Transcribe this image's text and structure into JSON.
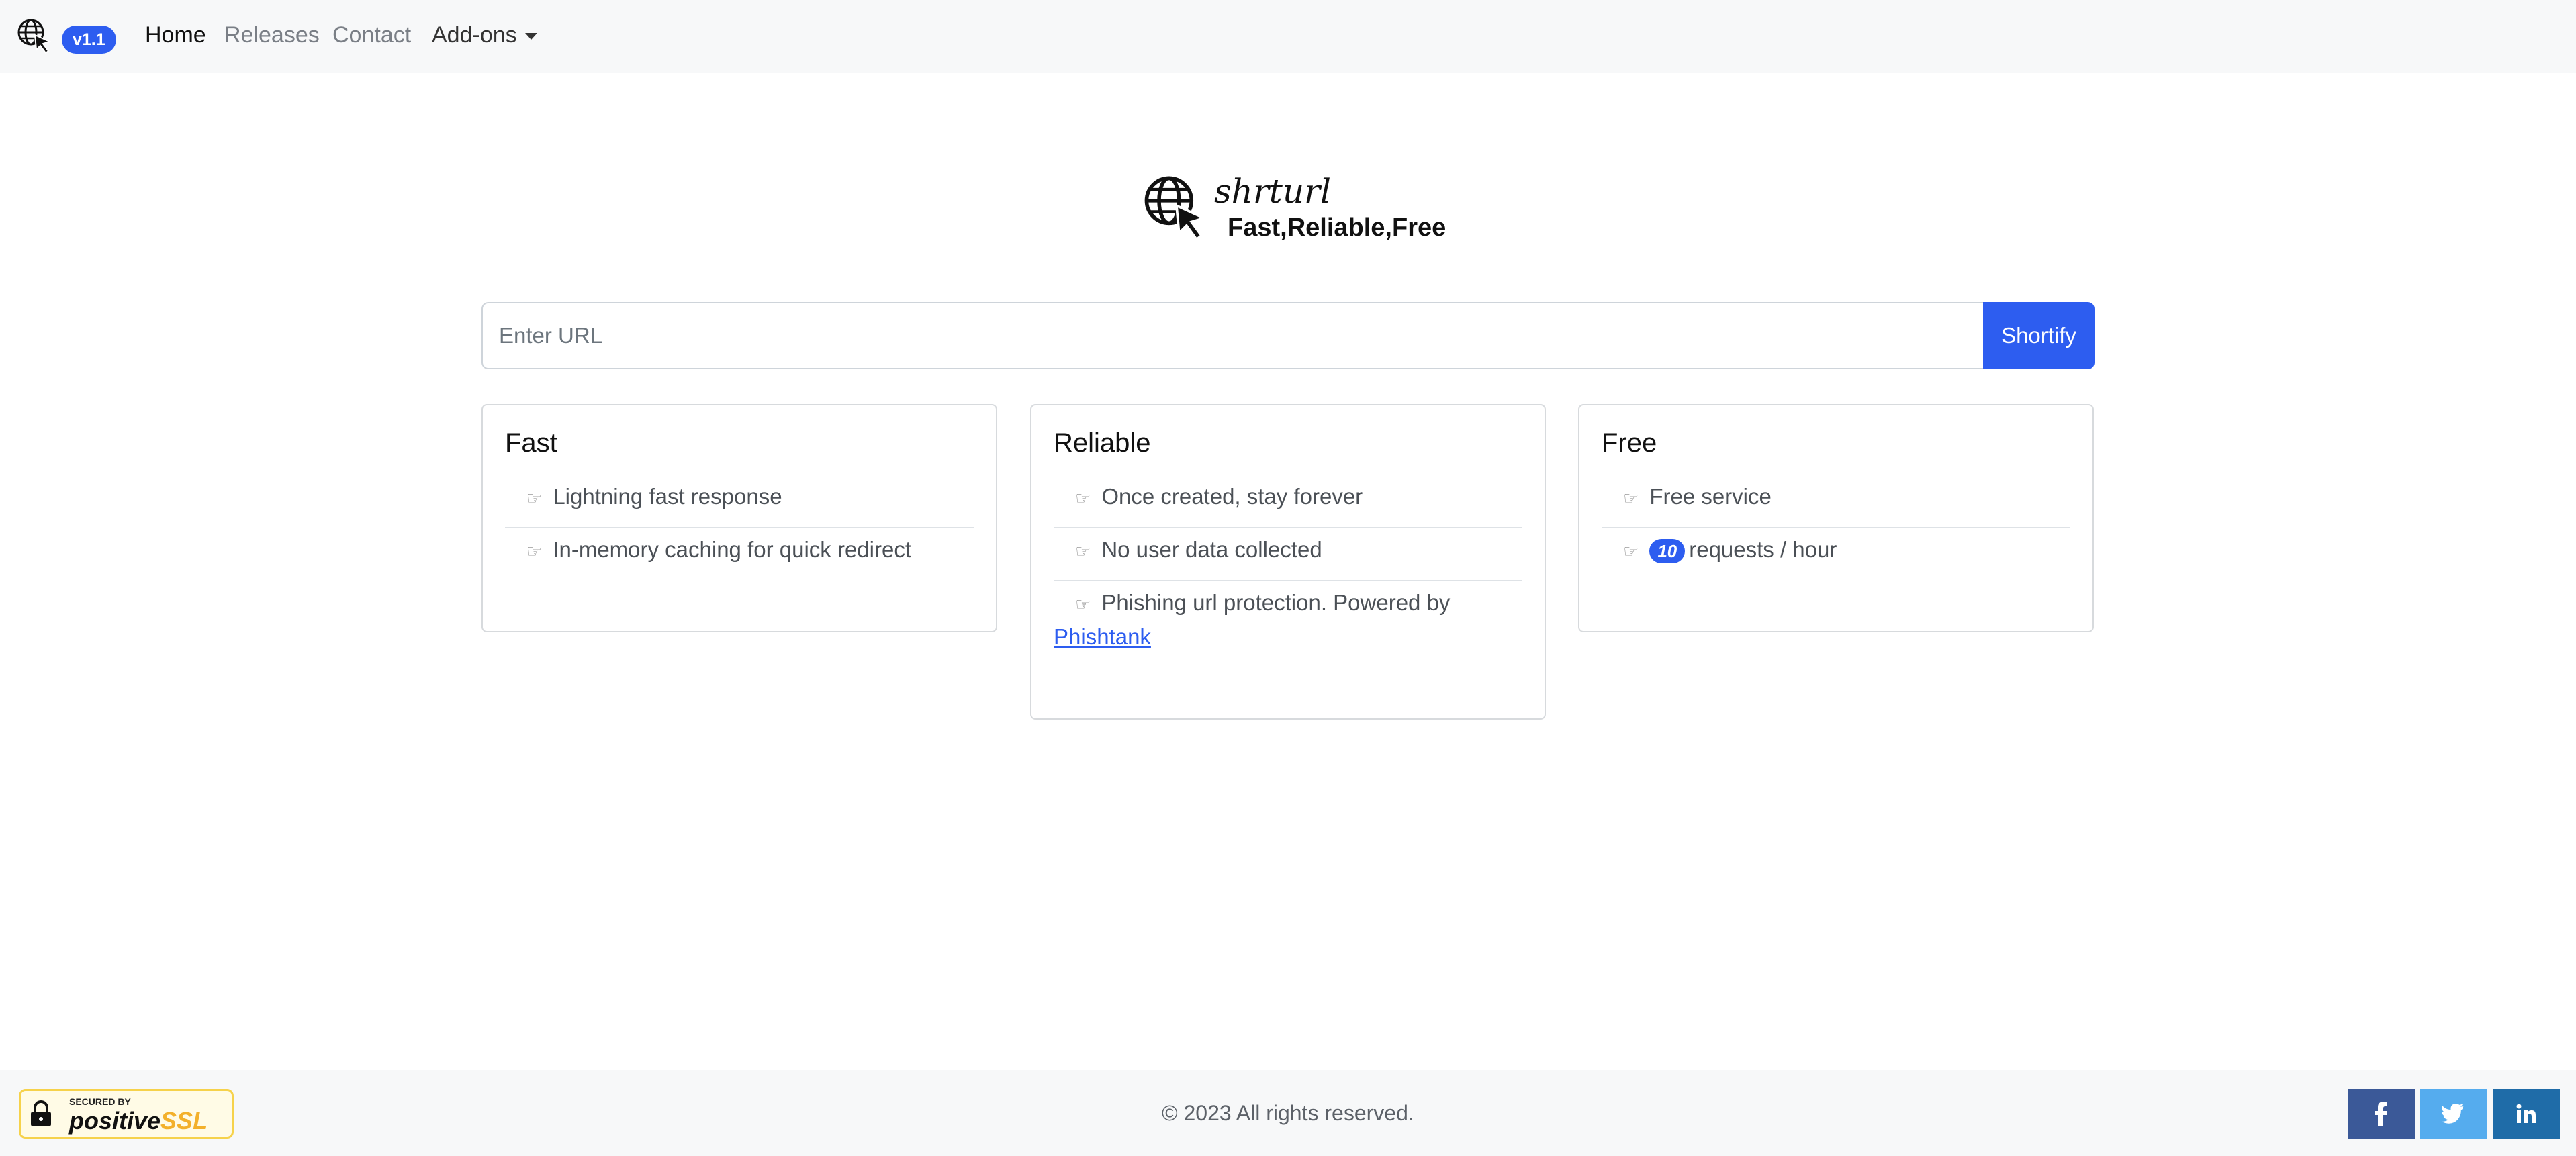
{
  "nav": {
    "version": "v1.1",
    "links": [
      "Home",
      "Releases",
      "Contact",
      "Add-ons"
    ]
  },
  "hero": {
    "title": "shrturl",
    "tagline": "Fast,Reliable,Free"
  },
  "form": {
    "placeholder": "Enter URL",
    "button": "Shortify"
  },
  "cards": [
    {
      "title": "Fast",
      "items": [
        "Lightning fast response",
        "In-memory caching for quick redirect"
      ]
    },
    {
      "title": "Reliable",
      "items": [
        "Once created, stay forever",
        "No user data collected",
        "Phishing url protection. Powered by"
      ],
      "link": "Phishtank"
    },
    {
      "title": "Free",
      "items": [
        "Free service"
      ],
      "rate": {
        "count": "10",
        "suffix": "requests / hour"
      }
    }
  ],
  "hand_icon": "☞",
  "footer": {
    "copyright": "© 2023 All rights reserved.",
    "ssl": {
      "small": "SECURED BY",
      "brand": "positive",
      "brand_suffix": "SSL"
    },
    "social": [
      "facebook-icon",
      "twitter-icon",
      "linkedin-icon"
    ]
  },
  "colors": {
    "accent": "#2d5df0",
    "facebook": "#3b5998",
    "twitter": "#55acee",
    "linkedin": "#1f6ca8"
  }
}
